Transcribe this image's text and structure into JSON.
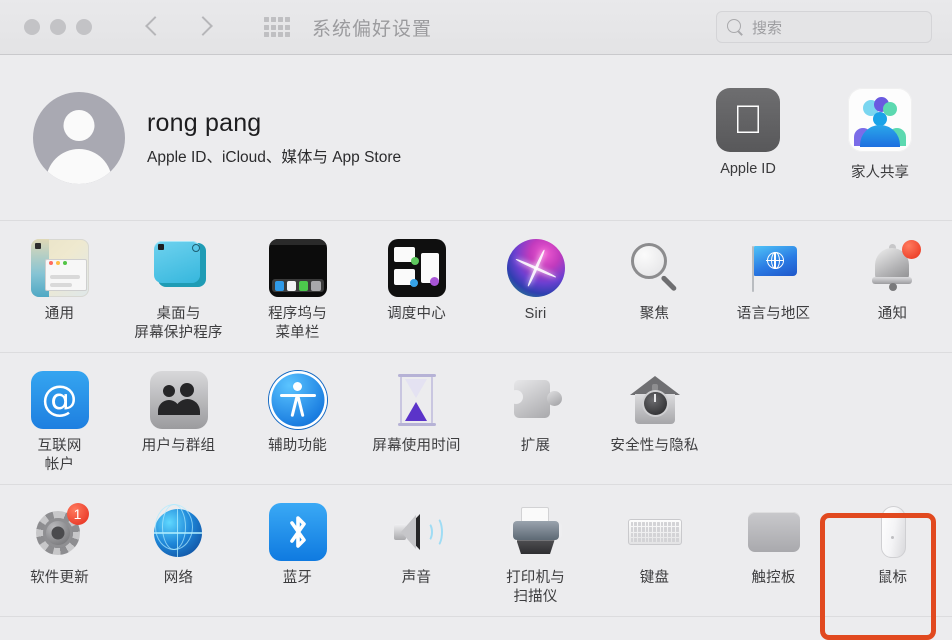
{
  "window": {
    "title": "系统偏好设置",
    "traffic_lights": [
      "close",
      "minimize",
      "zoom"
    ],
    "nav": {
      "back": "back-chevron",
      "forward": "forward-chevron",
      "grid": "show-all-grid"
    },
    "search": {
      "placeholder": "搜索",
      "value": "",
      "icon": "search-icon"
    }
  },
  "account": {
    "name": "rong pang",
    "subtitle": "Apple ID、iCloud、媒体与 App Store",
    "avatar_icon": "user-avatar-icon",
    "tiles": [
      {
        "label": "Apple ID",
        "icon": "apple-logo-icon"
      },
      {
        "label": "家人共享",
        "icon": "family-sharing-icon"
      }
    ]
  },
  "sections": [
    {
      "id": "personal",
      "items": [
        {
          "label": "通用",
          "icon": "general-icon"
        },
        {
          "label": "桌面与\n屏幕保护程序",
          "icon": "desktop-screensaver-icon"
        },
        {
          "label": "程序坞与\n菜单栏",
          "icon": "dock-menubar-icon"
        },
        {
          "label": "调度中心",
          "icon": "mission-control-icon"
        },
        {
          "label": "Siri",
          "icon": "siri-icon"
        },
        {
          "label": "聚焦",
          "icon": "spotlight-icon"
        },
        {
          "label": "语言与地区",
          "icon": "language-region-icon"
        },
        {
          "label": "通知",
          "icon": "notifications-icon",
          "badge": "dot"
        }
      ]
    },
    {
      "id": "accounts",
      "items": [
        {
          "label": "互联网\n帐户",
          "icon": "internet-accounts-icon"
        },
        {
          "label": "用户与群组",
          "icon": "users-groups-icon"
        },
        {
          "label": "辅助功能",
          "icon": "accessibility-icon"
        },
        {
          "label": "屏幕使用时间",
          "icon": "screen-time-icon"
        },
        {
          "label": "扩展",
          "icon": "extensions-icon"
        },
        {
          "label": "安全性与隐私",
          "icon": "security-privacy-icon"
        }
      ]
    },
    {
      "id": "hardware",
      "items": [
        {
          "label": "软件更新",
          "icon": "software-update-icon",
          "badge": "1"
        },
        {
          "label": "网络",
          "icon": "network-icon"
        },
        {
          "label": "蓝牙",
          "icon": "bluetooth-icon"
        },
        {
          "label": "声音",
          "icon": "sound-icon"
        },
        {
          "label": "打印机与\n扫描仪",
          "icon": "printers-scanners-icon"
        },
        {
          "label": "键盘",
          "icon": "keyboard-icon"
        },
        {
          "label": "触控板",
          "icon": "trackpad-icon"
        },
        {
          "label": "鼠标",
          "icon": "mouse-icon",
          "highlighted": true
        }
      ]
    }
  ],
  "highlight": {
    "target": "鼠标",
    "color": "#e1491f"
  }
}
